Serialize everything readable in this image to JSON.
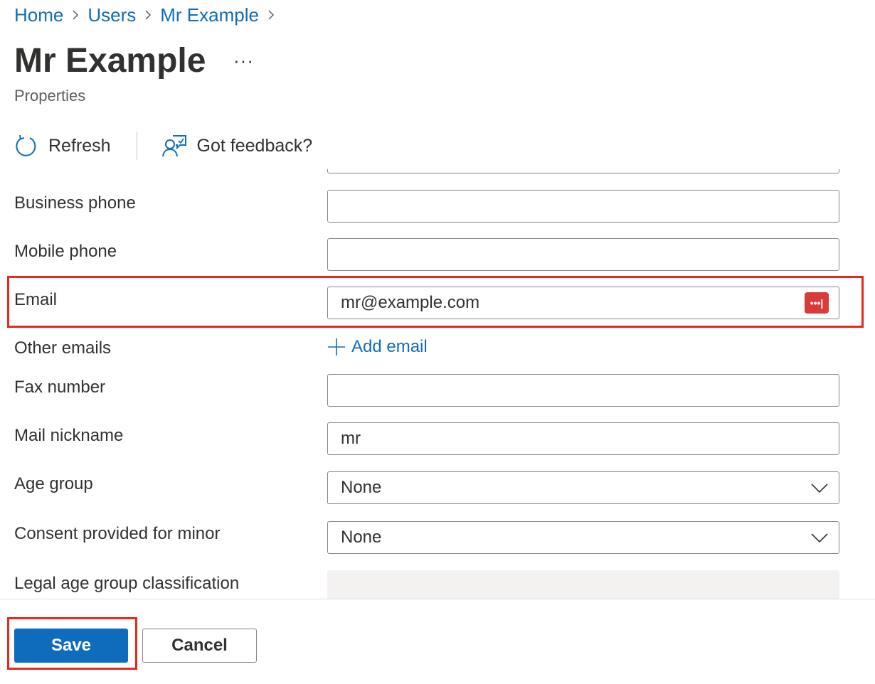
{
  "breadcrumb": [
    {
      "label": "Home"
    },
    {
      "label": "Users"
    },
    {
      "label": "Mr Example"
    }
  ],
  "header": {
    "title": "Mr Example",
    "more_label": "···",
    "subtitle": "Properties"
  },
  "toolbar": {
    "refresh_label": "Refresh",
    "feedback_label": "Got feedback?"
  },
  "form": {
    "business_phone": {
      "label": "Business phone",
      "value": ""
    },
    "mobile_phone": {
      "label": "Mobile phone",
      "value": ""
    },
    "email": {
      "label": "Email",
      "value": "mr@example.com",
      "badge": "•••|"
    },
    "other_emails": {
      "label": "Other emails",
      "link": "Add email"
    },
    "fax_number": {
      "label": "Fax number",
      "value": ""
    },
    "mail_nickname": {
      "label": "Mail nickname",
      "value": "mr"
    },
    "age_group": {
      "label": "Age group",
      "value": "None"
    },
    "consent_minor": {
      "label": "Consent provided for minor",
      "value": "None"
    },
    "legal_age": {
      "label": "Legal age group classification",
      "value": ""
    }
  },
  "footer": {
    "save_label": "Save",
    "cancel_label": "Cancel"
  },
  "colors": {
    "accent": "#0f6cbd",
    "highlight": "#e8281a",
    "badge": "#d93b3b"
  },
  "icons": [
    "chevron-right-icon",
    "refresh-icon",
    "feedback-icon",
    "chevron-down-icon",
    "plus-icon",
    "password-manager-icon"
  ]
}
